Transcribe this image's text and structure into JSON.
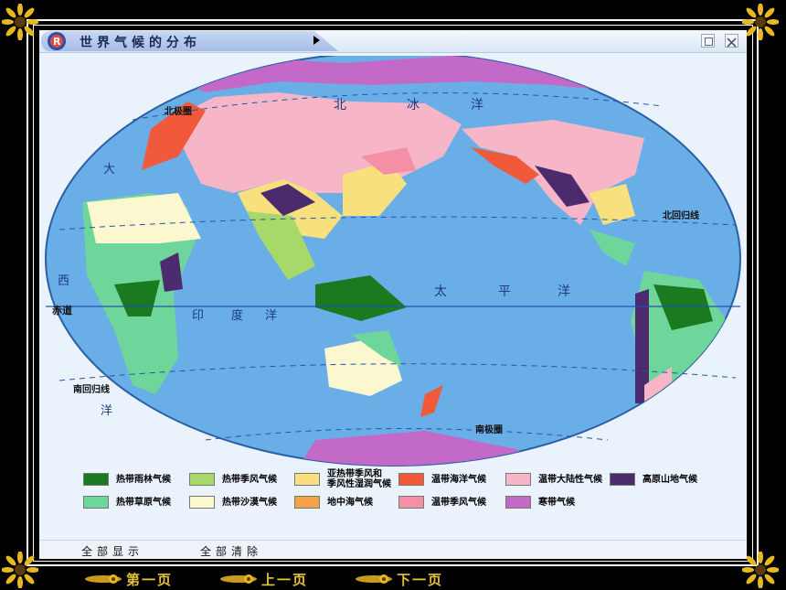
{
  "window": {
    "title": "世界气候的分布"
  },
  "map": {
    "labels": {
      "arctic_circle": "北极圈",
      "north_sea": "北",
      "ice_sea": "冰",
      "ocean_top": "洋",
      "tropic_cancer": "北回归线",
      "da": "大",
      "xi": "西",
      "equator": "赤道",
      "indian_yin": "印",
      "indian_du": "度",
      "indian_yang": "洋",
      "pacific_tai": "太",
      "pacific_ping": "平",
      "pacific_yang": "洋",
      "tropic_capricorn": "南回归线",
      "atlantic_yang": "洋",
      "antarctic_circle": "南极圈"
    }
  },
  "legend": [
    {
      "label": "热带雨林气候",
      "color": "#1b7a1f"
    },
    {
      "label": "热带季风气候",
      "color": "#a6d86a"
    },
    {
      "label": "亚热带季风和\n季风性湿润气候",
      "color": "#f7e07d"
    },
    {
      "label": "温带海洋气候",
      "color": "#f05a3a"
    },
    {
      "label": "温带大陆性气候",
      "color": "#f7b6c8"
    },
    {
      "label": "高原山地气候",
      "color": "#4b2a6e"
    },
    {
      "label": "热带草原气候",
      "color": "#6ed69a"
    },
    {
      "label": "热带沙漠气候",
      "color": "#fbf7cf"
    },
    {
      "label": "地中海气候",
      "color": "#f5a04a"
    },
    {
      "label": "温带季风气候",
      "color": "#f48fa6"
    },
    {
      "label": "寒带气候",
      "color": "#c36ac8"
    }
  ],
  "bottom": {
    "show_all": "全部显示",
    "clear_all": "全部清除"
  },
  "nav": {
    "first": "第一页",
    "prev": "上一页",
    "next": "下一页"
  },
  "colors": {
    "ocean": "#6aaee8",
    "background": "#000000",
    "titlebar": "#a6bde6"
  }
}
